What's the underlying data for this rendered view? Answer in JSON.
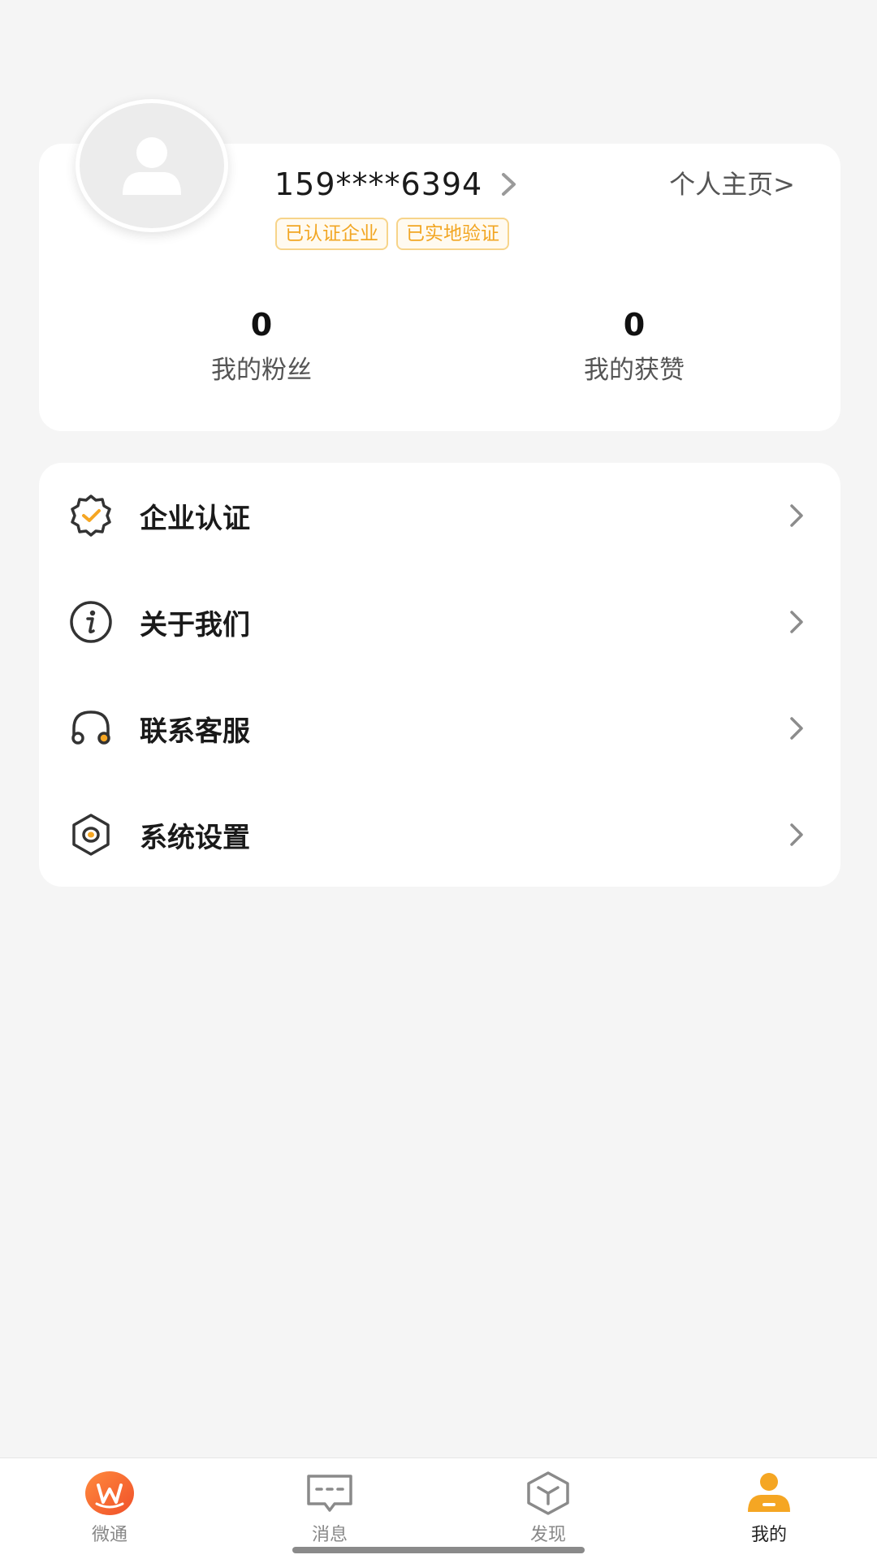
{
  "profile": {
    "phone": "159****6394",
    "homepage_link": "个人主页>",
    "badges": [
      "已认证企业",
      "已实地验证"
    ],
    "stats": [
      {
        "value": "0",
        "label": "我的粉丝"
      },
      {
        "value": "0",
        "label": "我的获赞"
      }
    ]
  },
  "menu": {
    "items": [
      {
        "label": "企业认证",
        "icon": "verified-badge-icon"
      },
      {
        "label": "关于我们",
        "icon": "info-icon"
      },
      {
        "label": "联系客服",
        "icon": "headset-icon"
      },
      {
        "label": "系统设置",
        "icon": "settings-hexagon-icon"
      }
    ]
  },
  "bottom_nav": {
    "items": [
      {
        "label": "微通",
        "icon": "app-logo-icon"
      },
      {
        "label": "消息",
        "icon": "message-icon"
      },
      {
        "label": "发现",
        "icon": "discover-cube-icon"
      },
      {
        "label": "我的",
        "icon": "person-icon",
        "active": true
      }
    ]
  },
  "colors": {
    "accent": "#f5a623",
    "badge_text": "#f2a623",
    "background": "#f5f5f5"
  }
}
